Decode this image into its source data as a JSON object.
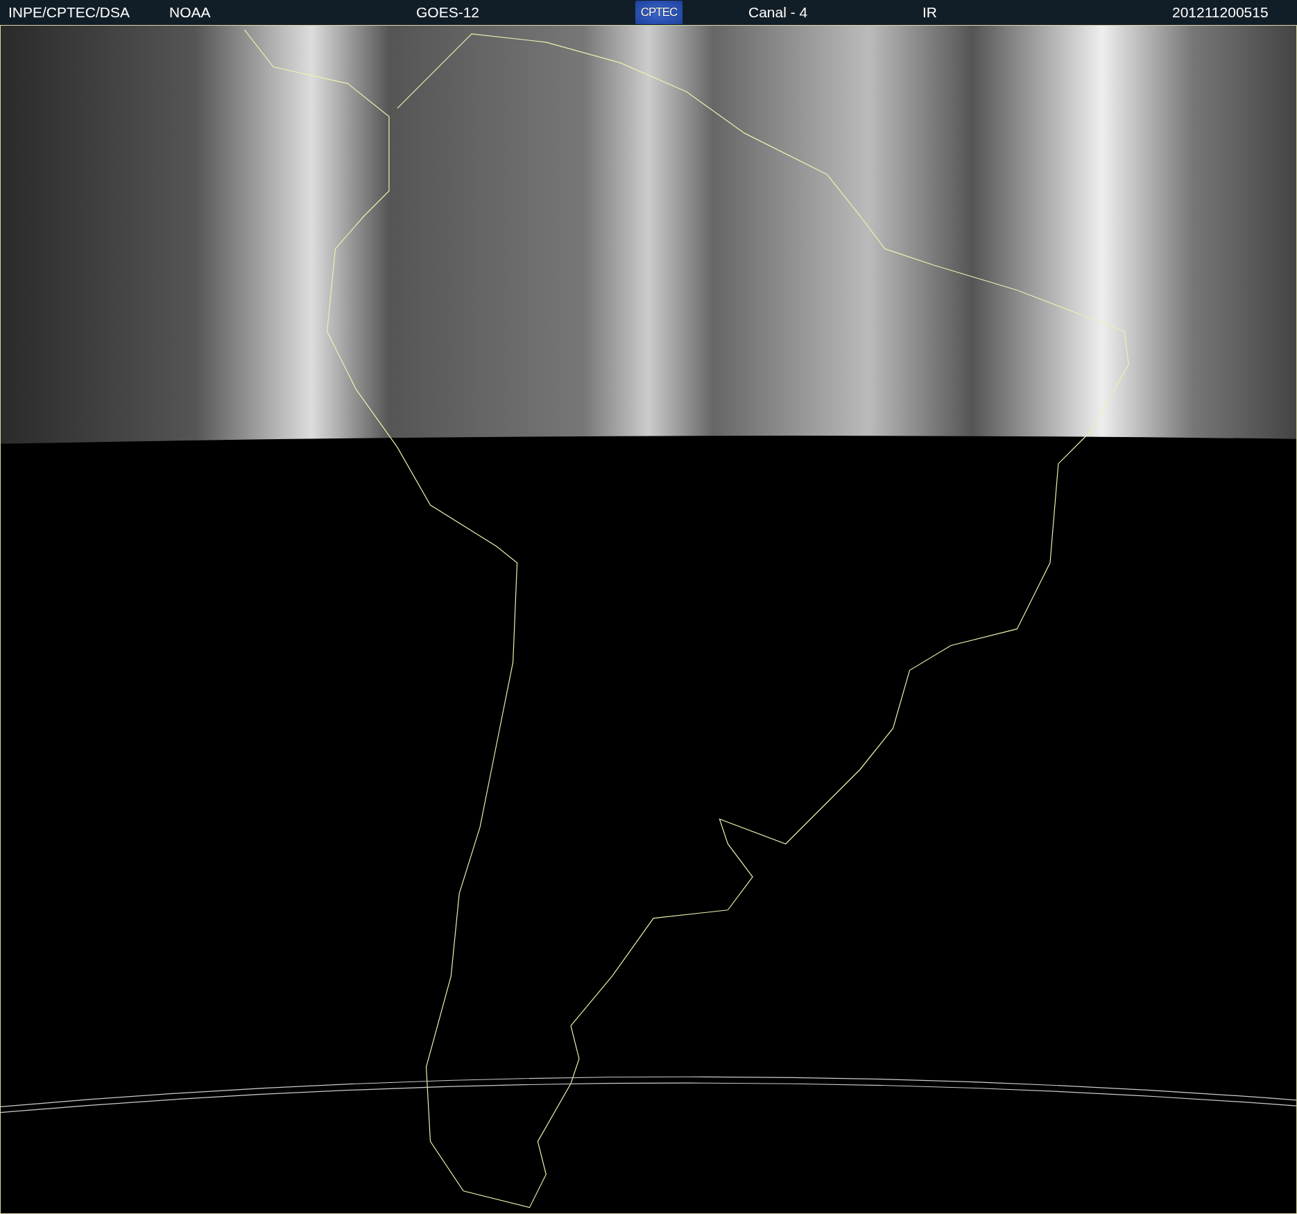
{
  "header": {
    "source": "INPE/CPTEC/DSA",
    "agency": "NOAA",
    "satellite": "GOES-12",
    "logo": "CPTEC",
    "channel": "Canal - 4",
    "band": "IR",
    "timestamp": "201211200515"
  }
}
